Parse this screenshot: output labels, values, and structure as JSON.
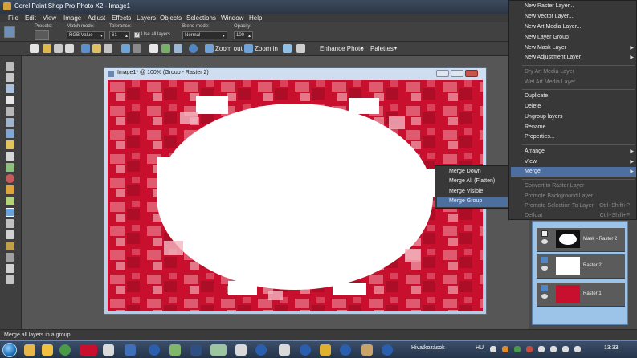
{
  "app": {
    "title": "Corel Paint Shop Pro Photo X2 - Image1"
  },
  "menubar": [
    "File",
    "Edit",
    "View",
    "Image",
    "Adjust",
    "Effects",
    "Layers",
    "Objects",
    "Selections",
    "Window",
    "Help"
  ],
  "tool_options": {
    "presets_label": "Presets:",
    "match_mode_label": "Match mode:",
    "match_mode_value": "RGB Value",
    "tolerance_label": "Tolerance:",
    "tolerance_value": "61",
    "use_all_layers_label": "Use all layers",
    "blend_mode_label": "Blend mode:",
    "blend_mode_value": "Normal",
    "opacity_label": "Opacity:",
    "opacity_value": "100"
  },
  "toolbar": {
    "zoom_out": "Zoom out",
    "zoom_in": "Zoom in",
    "enhance_photo": "Enhance Photo",
    "palettes": "Palettes"
  },
  "document": {
    "title": "Image1* @ 100% (Group - Raster 2)"
  },
  "context_menu": {
    "items": [
      {
        "label": "New Raster Layer...",
        "enabled": true
      },
      {
        "label": "New Vector Layer...",
        "enabled": true
      },
      {
        "label": "New Art Media Layer...",
        "enabled": true
      },
      {
        "label": "New Layer Group",
        "enabled": true
      },
      {
        "label": "New Mask Layer",
        "enabled": true,
        "submenu": true
      },
      {
        "label": "New Adjustment Layer",
        "enabled": true,
        "submenu": true
      },
      {
        "label": "Dry Art Media Layer",
        "enabled": false
      },
      {
        "label": "Wet Art Media Layer",
        "enabled": false
      },
      {
        "label": "Duplicate",
        "enabled": true
      },
      {
        "label": "Delete",
        "enabled": true
      },
      {
        "label": "Ungroup layers",
        "enabled": true
      },
      {
        "label": "Rename",
        "enabled": true
      },
      {
        "label": "Properties...",
        "enabled": true
      },
      {
        "label": "Arrange",
        "enabled": true,
        "submenu": true
      },
      {
        "label": "View",
        "enabled": true,
        "submenu": true
      },
      {
        "label": "Merge",
        "enabled": true,
        "submenu": true,
        "highlighted": true
      },
      {
        "label": "Convert to Raster Layer",
        "enabled": false
      },
      {
        "label": "Promote Background Layer",
        "enabled": false
      },
      {
        "label": "Promote Selection To Layer",
        "enabled": false,
        "shortcut": "Ctrl+Shift+P"
      },
      {
        "label": "Defloat",
        "enabled": false,
        "shortcut": "Ctrl+Shift+F"
      }
    ]
  },
  "merge_submenu": {
    "items": [
      {
        "label": "Merge Down"
      },
      {
        "label": "Merge All (Flatten)"
      },
      {
        "label": "Merge Visible"
      },
      {
        "label": "Merge Group",
        "highlighted": true
      }
    ]
  },
  "layers": [
    {
      "name": "Mask - Raster 2",
      "kind": "mask"
    },
    {
      "name": "Raster 2",
      "kind": "white"
    },
    {
      "name": "Raster 1",
      "kind": "red"
    }
  ],
  "status": {
    "text": "Merge all layers in a group"
  },
  "taskbar": {
    "toolbar_label": "Hivatkozások",
    "language": "HU",
    "time": "13:33"
  },
  "colors": {
    "canvas_red": "#c8102e",
    "menu_highlight": "#4c6f9f"
  }
}
